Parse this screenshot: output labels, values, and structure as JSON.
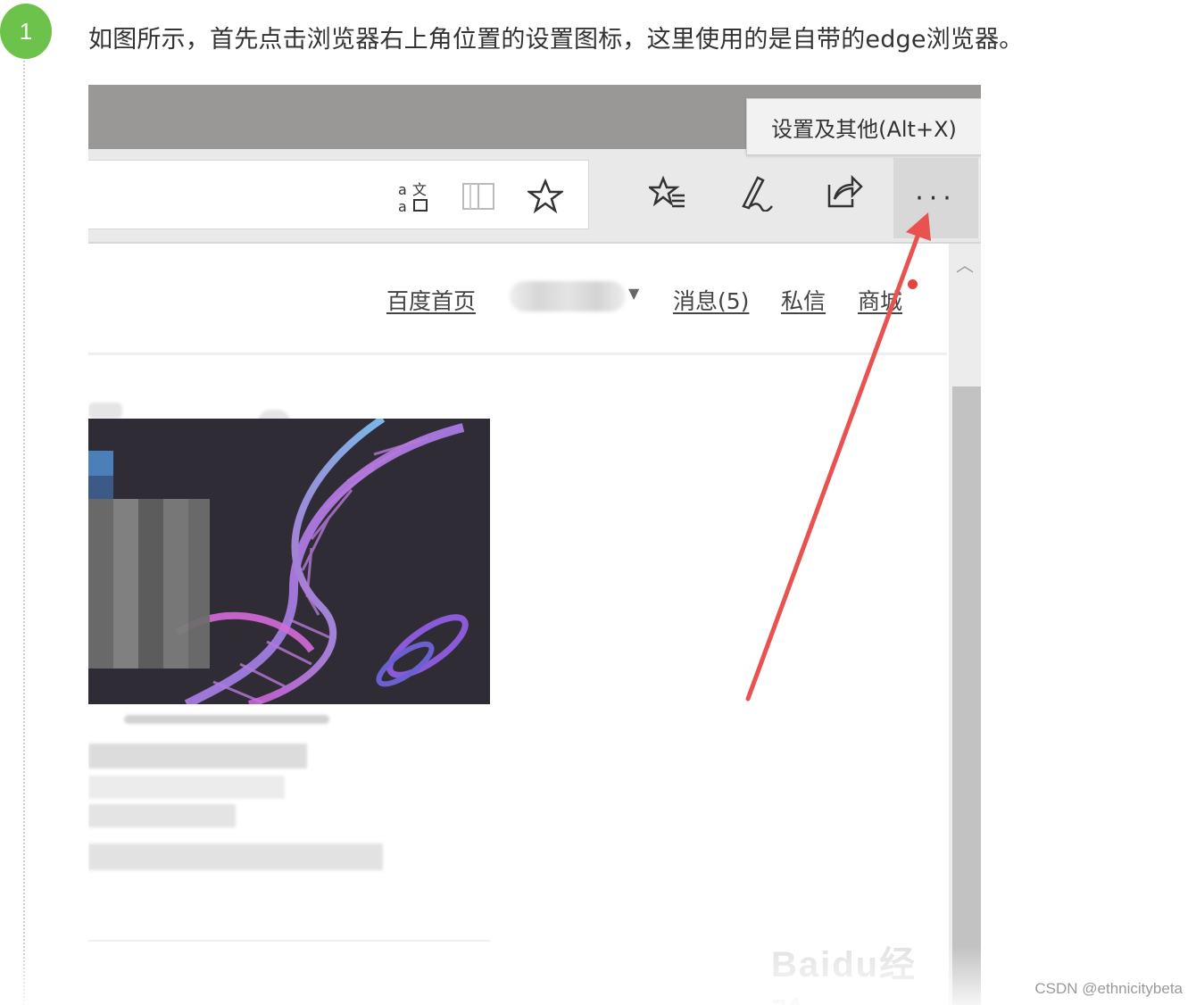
{
  "step": {
    "number": "1",
    "instruction": "如图所示，首先点击浏览器右上角位置的设置图标，这里使用的是自带的edge浏览器。"
  },
  "browser": {
    "tooltip": "设置及其他(Alt+X)",
    "toolbar_icons": [
      "translate-icon",
      "reading-view-icon",
      "favorite-star-icon",
      "favorites-list-icon",
      "pen-icon",
      "share-icon",
      "more-icon"
    ],
    "more_button_label": "···"
  },
  "page_nav": {
    "links": [
      "百度首页",
      "消息(5)",
      "私信",
      "商城"
    ]
  },
  "annotation": {
    "arrow_color": "#e8524f"
  },
  "watermarks": {
    "baidu": "Baidu经验",
    "csdn": "CSDN @ethnicitybeta"
  },
  "colors": {
    "step_badge": "#6cc24a",
    "titlebar": "#9a9897",
    "toolbar": "#e9e9e9"
  }
}
